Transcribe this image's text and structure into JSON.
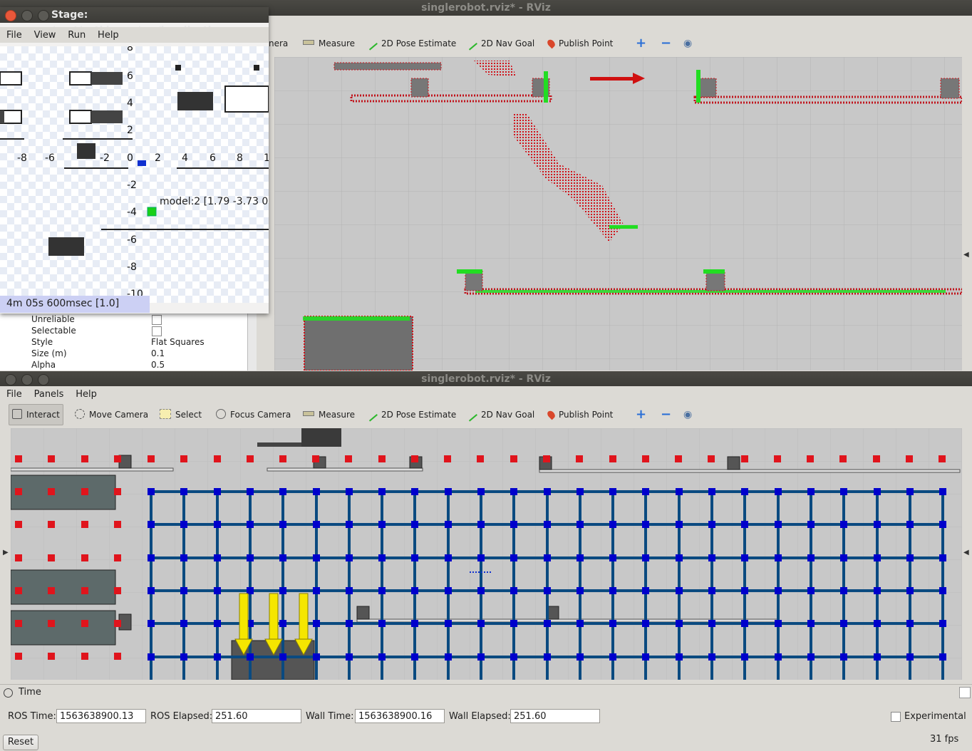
{
  "top_window": {
    "title": "singlerobot.rviz* - RViz",
    "toolbar": {
      "camera_partial": "nera",
      "measure": "Measure",
      "pose_estimate": "2D Pose Estimate",
      "nav_goal": "2D Nav Goal",
      "publish_point": "Publish Point"
    },
    "properties": [
      {
        "name": "Unreliable",
        "value": ""
      },
      {
        "name": "Selectable",
        "value": ""
      },
      {
        "name": "Style",
        "value": "Flat Squares"
      },
      {
        "name": "Size (m)",
        "value": "0.1"
      },
      {
        "name": "Alpha",
        "value": "0.5"
      }
    ]
  },
  "stage_window": {
    "title": "Stage: /root/catkin_ws/src/localizatio...",
    "menu": [
      "File",
      "View",
      "Run",
      "Help"
    ],
    "y_ticks": [
      "8",
      "6",
      "4",
      "2",
      "0",
      "-2",
      "-4",
      "-6",
      "-8",
      "-10"
    ],
    "x_ticks": [
      "-8",
      "-6",
      "-2",
      "2",
      "4",
      "6",
      "8",
      "1"
    ],
    "model_label": "model:2 [1.79 -3.73 0",
    "sim_time": "4m 05s 600msec [1.0]"
  },
  "bottom_window": {
    "title": "singlerobot.rviz* - RViz",
    "menu": [
      "File",
      "Panels",
      "Help"
    ],
    "toolbar": {
      "interact": "Interact",
      "move_camera": "Move Camera",
      "select": "Select",
      "focus_camera": "Focus Camera",
      "measure": "Measure",
      "pose_estimate": "2D Pose Estimate",
      "nav_goal": "2D Nav Goal",
      "publish_point": "Publish Point"
    }
  },
  "time_panel": {
    "title": "Time",
    "ros_time_label": "ROS Time:",
    "ros_time": "1563638900.13",
    "ros_elapsed_label": "ROS Elapsed:",
    "ros_elapsed": "251.60",
    "wall_time_label": "Wall Time:",
    "wall_time": "1563638900.16",
    "wall_elapsed_label": "Wall Elapsed:",
    "wall_elapsed": "251.60",
    "experimental_label": "Experimental",
    "reset_label": "Reset",
    "fps": "31 fps"
  },
  "colors": {
    "grid_node": "#0000cc",
    "grid_edge": "#0a4a80",
    "occupied": "#e0141c",
    "laser": "#22dd22",
    "arrow": "#d01010",
    "goal_arrow": "#f5e600"
  }
}
